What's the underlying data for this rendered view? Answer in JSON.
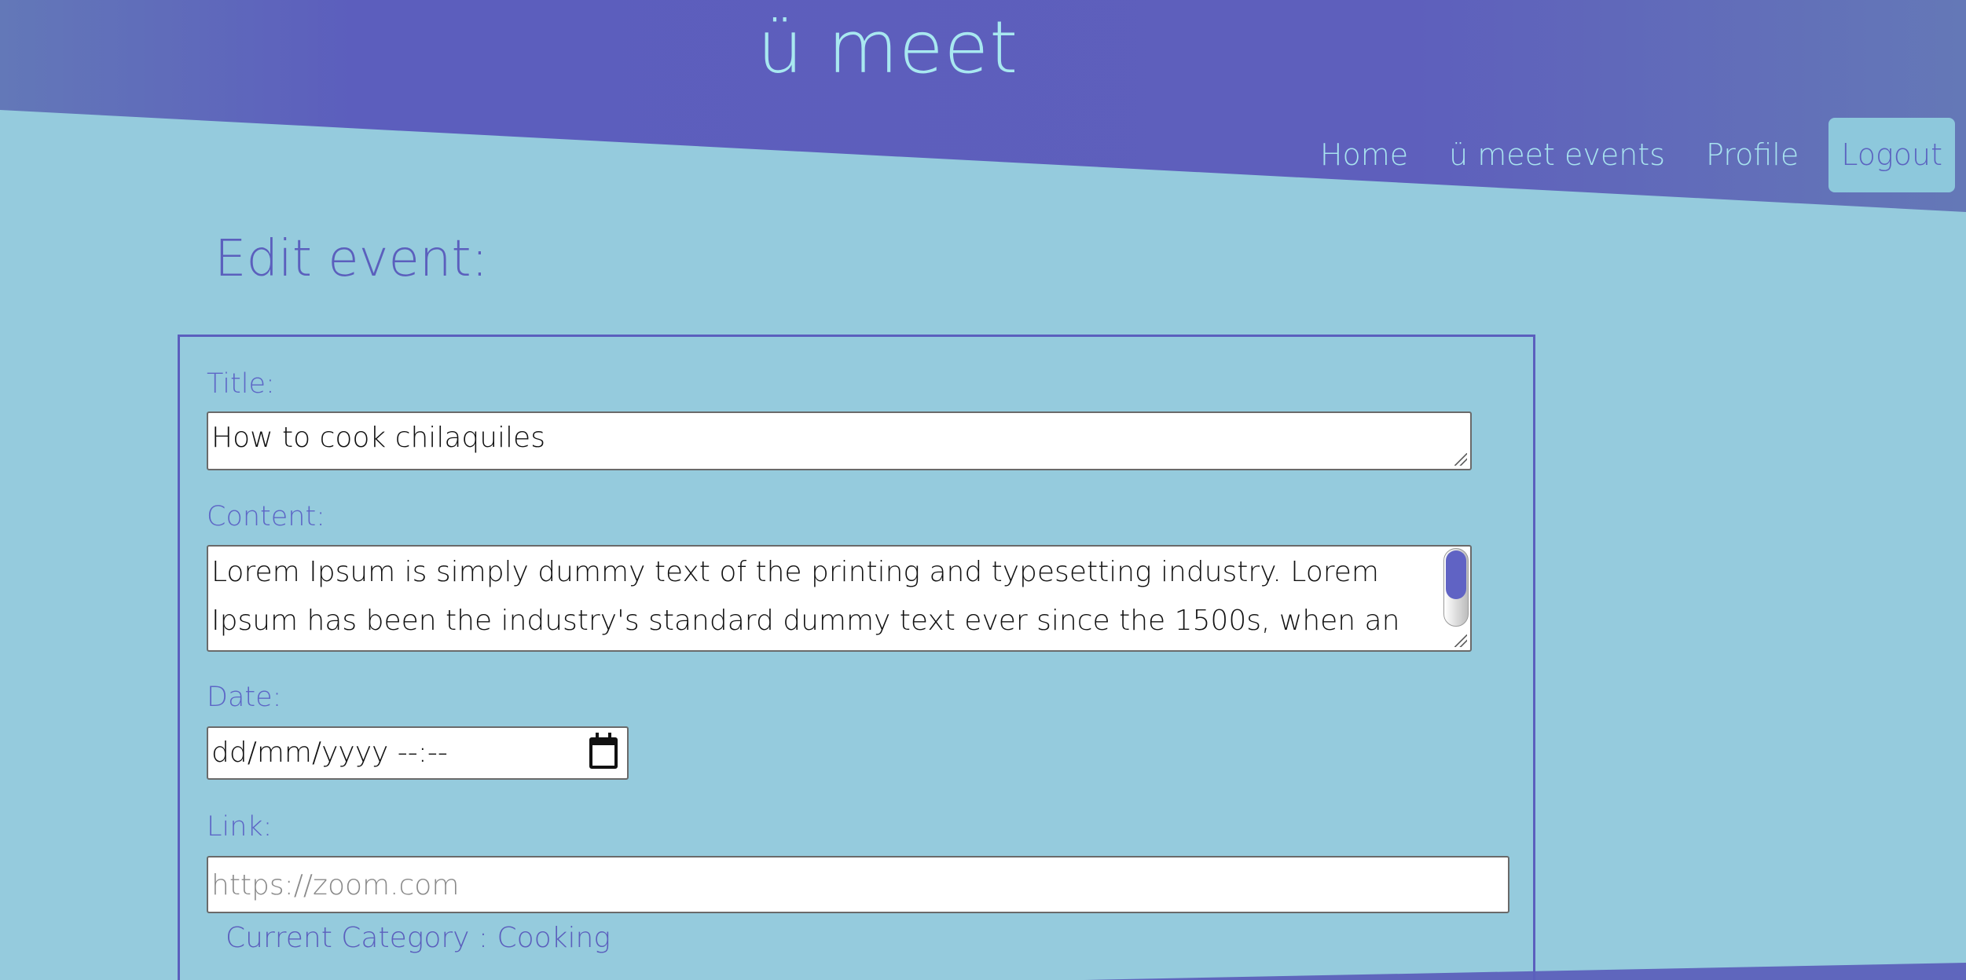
{
  "header": {
    "site_title": "ü meet",
    "nav": [
      "Home",
      "ü meet events",
      "Profile",
      "Logout"
    ]
  },
  "page": {
    "heading": "Edit event:"
  },
  "form": {
    "title_label": "Title:",
    "title_value": "How to cook chilaquiles",
    "content_label": "Content:",
    "content_value": "Lorem Ipsum is simply dummy text of the printing and typesetting industry. Lorem Ipsum has been the industry's standard dummy text ever since the 1500s, when an unknown printer took a",
    "date_label": "Date:",
    "date_value": "dd/mm/yyyy --:--",
    "link_label": "Link:",
    "link_placeholder": "https://zoom.com",
    "current_category": "Current Category : Cooking"
  },
  "colors": {
    "background": "#95cbdd",
    "header_purple": "#5f5fbd",
    "accent": "#5b5fbd",
    "title_text": "#a8e8f0"
  },
  "icons": {
    "date_picker": "calendar-icon"
  }
}
